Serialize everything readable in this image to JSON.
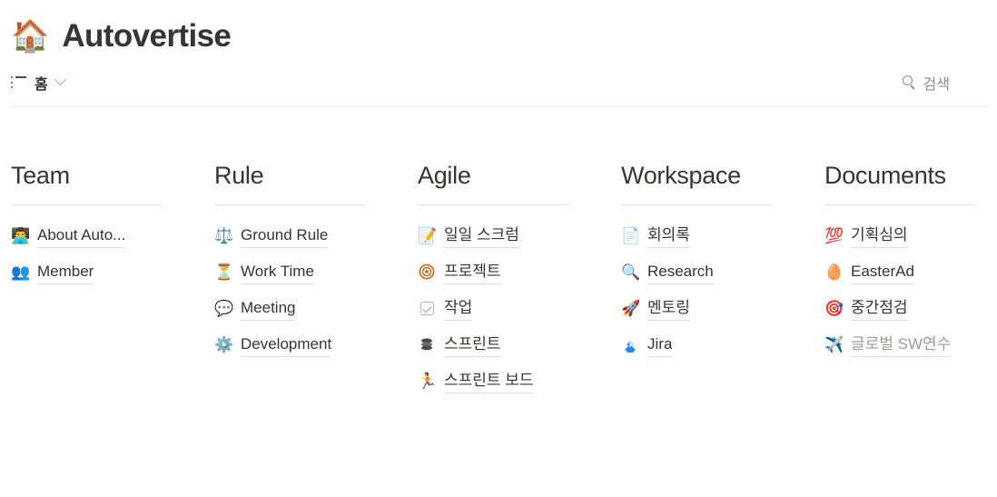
{
  "header": {
    "icon": "house-emoji",
    "icon_glyph": "🏠",
    "title": "Autovertise"
  },
  "navbar": {
    "list_icon": "list-icon",
    "home_label": "홈",
    "chevron_icon": "chevron-down-icon",
    "search_icon": "search-icon",
    "search_label": "검색"
  },
  "colors": {
    "text": "#37352f",
    "muted": "#9b9a97",
    "divider": "#e3e2e0",
    "underline": "#dfdedb",
    "jira_blue": "#2684ff",
    "accent_orange": "#d2691e"
  },
  "columns": [
    {
      "heading": "Team",
      "items": [
        {
          "label": "About Auto...",
          "icon": "person-at-laptop-icon",
          "glyph": "👨‍💻",
          "muted": false
        },
        {
          "label": "Member",
          "icon": "busts-in-silhouette-icon",
          "glyph": "👥",
          "muted": false
        }
      ]
    },
    {
      "heading": "Rule",
      "items": [
        {
          "label": "Ground Rule",
          "icon": "balance-scale-icon",
          "glyph": "⚖️",
          "muted": false
        },
        {
          "label": "Work Time",
          "icon": "hourglass-icon",
          "glyph": "⏳",
          "muted": false
        },
        {
          "label": "Meeting",
          "icon": "speech-balloon-icon",
          "glyph": "💬",
          "muted": false
        },
        {
          "label": "Development",
          "icon": "gear-icon",
          "glyph": "⚙️",
          "muted": false
        }
      ]
    },
    {
      "heading": "Agile",
      "items": [
        {
          "label": "일일 스크럼",
          "icon": "memo-pencil-icon",
          "glyph": "📝",
          "muted": false
        },
        {
          "label": "프로젝트",
          "icon": "bullseye-icon",
          "glyph": "",
          "muted": false
        },
        {
          "label": "작업",
          "icon": "checkbox-icon",
          "glyph": "",
          "muted": false
        },
        {
          "label": "스프린트",
          "icon": "stacked-disks-icon",
          "glyph": "",
          "muted": false
        },
        {
          "label": "스프린트 보드",
          "icon": "runner-icon",
          "glyph": "🏃",
          "muted": false
        }
      ]
    },
    {
      "heading": "Workspace",
      "items": [
        {
          "label": "회의록",
          "icon": "page-document-icon",
          "glyph": "📄",
          "muted": false
        },
        {
          "label": "Research",
          "icon": "magnifying-glass-icon",
          "glyph": "🔍",
          "muted": false
        },
        {
          "label": "멘토링",
          "icon": "rocket-icon",
          "glyph": "🚀",
          "muted": false
        },
        {
          "label": "Jira",
          "icon": "jira-logo-icon",
          "glyph": "",
          "muted": false
        }
      ]
    },
    {
      "heading": "Documents",
      "items": [
        {
          "label": "기획심의",
          "icon": "hundred-points-icon",
          "glyph": "💯",
          "muted": false
        },
        {
          "label": "EasterAd",
          "icon": "egg-icon",
          "glyph": "🥚",
          "muted": false
        },
        {
          "label": "중간점검",
          "icon": "dart-target-icon",
          "glyph": "🎯",
          "muted": false
        },
        {
          "label": "글로벌 SW연수",
          "icon": "airplane-icon",
          "glyph": "✈️",
          "muted": true
        }
      ]
    }
  ]
}
